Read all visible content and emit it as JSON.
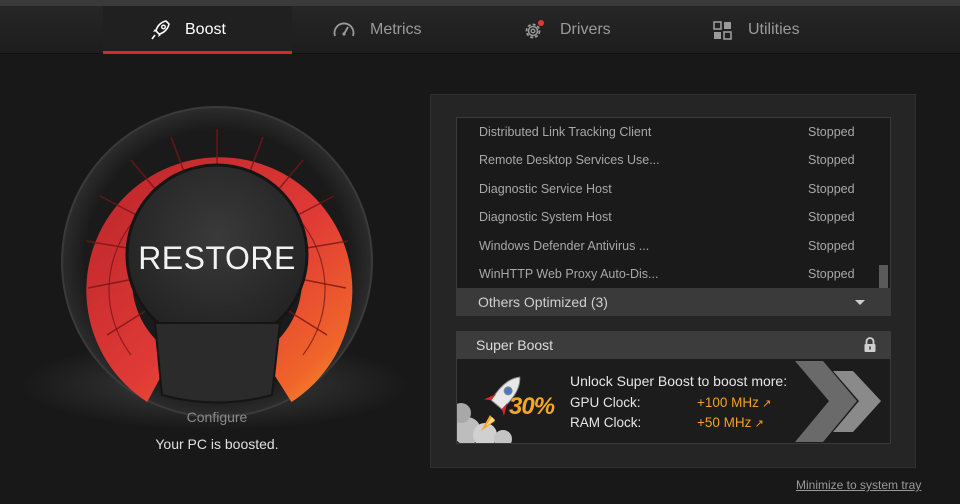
{
  "tabs": [
    {
      "label": "Boost",
      "icon": "rocket-icon",
      "active": true
    },
    {
      "label": "Metrics",
      "icon": "speedometer-icon",
      "active": false
    },
    {
      "label": "Drivers",
      "icon": "gear-icon",
      "active": false
    },
    {
      "label": "Utilities",
      "icon": "grid-icon",
      "active": false
    }
  ],
  "gauge": {
    "button_label": "RESTORE",
    "configure_label": "Configure",
    "status": "Your PC is boosted."
  },
  "services": [
    {
      "name": "Distributed Link Tracking Client",
      "status": "Stopped"
    },
    {
      "name": "Remote Desktop Services Use...",
      "status": "Stopped"
    },
    {
      "name": "Diagnostic Service Host",
      "status": "Stopped"
    },
    {
      "name": "Diagnostic System Host",
      "status": "Stopped"
    },
    {
      "name": "Windows Defender Antivirus ...",
      "status": "Stopped"
    },
    {
      "name": "WinHTTP Web Proxy Auto-Dis...",
      "status": "Stopped"
    }
  ],
  "others_optimized": "Others Optimized (3)",
  "super_boost": {
    "title": "Super Boost",
    "unlock_text": "Unlock Super Boost to boost more:",
    "gpu_label": "GPU Clock:",
    "gpu_value": "+100 MHz",
    "ram_label": "RAM Clock:",
    "ram_value": "+50 MHz",
    "percent": "30%"
  },
  "minimize_link": "Minimize to system tray",
  "colors": {
    "accent": "#d8272d",
    "orange": "#f5a020",
    "background": "#181818",
    "panel": "#252525"
  }
}
